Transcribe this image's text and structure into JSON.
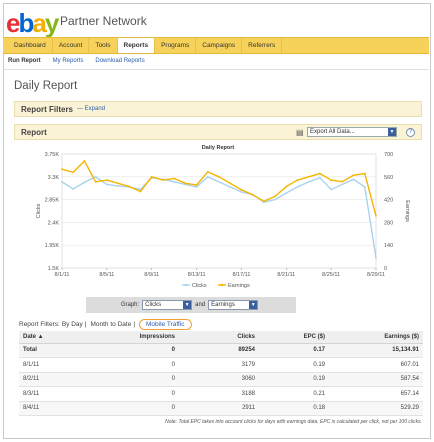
{
  "brand": {
    "logo_e": "e",
    "logo_b": "b",
    "logo_a": "a",
    "logo_y": "y",
    "name": "Partner Network"
  },
  "nav": [
    "Dashboard",
    "Account",
    "Tools",
    "Reports",
    "Programs",
    "Campaigns",
    "Referrers"
  ],
  "nav_active": "Reports",
  "subnav": [
    "Run Report",
    "My Reports",
    "Download Reports"
  ],
  "page_title": "Daily Report",
  "filters": {
    "title": "Report Filters",
    "expand": "— Expand"
  },
  "report": {
    "title": "Report",
    "export": "Export All Data...",
    "help": "?"
  },
  "chart_data": {
    "type": "line",
    "title": "Daily Report",
    "x": [
      "8/1/11",
      "8/2/11",
      "8/3/11",
      "8/4/11",
      "8/5/11",
      "8/6/11",
      "8/7/11",
      "8/8/11",
      "8/9/11",
      "8/10/11",
      "8/11/11",
      "8/12/11",
      "8/13/11",
      "8/14/11",
      "8/15/11",
      "8/16/11",
      "8/17/11",
      "8/18/11",
      "8/19/11",
      "8/20/11",
      "8/21/11",
      "8/22/11",
      "8/23/11",
      "8/24/11",
      "8/25/11",
      "8/26/11",
      "8/27/11",
      "8/28/11",
      "8/29/11"
    ],
    "xticks": [
      "8/1/11",
      "8/5/11",
      "8/9/11",
      "8/13/11",
      "8/17/11",
      "8/21/11",
      "8/25/11",
      "8/29/11"
    ],
    "ylabel": "Clicks",
    "y2label": "Earnings",
    "ylim": [
      1500,
      3750
    ],
    "y2lim": [
      0,
      700
    ],
    "yticks": [
      "3.75K",
      "3.3K",
      "2.85K",
      "2.4K",
      "1.95K",
      "1.5K"
    ],
    "y2ticks": [
      "700",
      "560",
      "420",
      "280",
      "140",
      "0"
    ],
    "series": [
      {
        "name": "Clicks",
        "color": "#a9d3ec",
        "axis": "left",
        "values": [
          3200,
          3060,
          3190,
          3300,
          3150,
          3120,
          3100,
          3050,
          3280,
          3250,
          3200,
          3150,
          3100,
          3300,
          3200,
          3100,
          3000,
          2950,
          2800,
          2850,
          2980,
          3100,
          3200,
          3280,
          3050,
          3150,
          3250,
          3100,
          1700
        ]
      },
      {
        "name": "Earnings",
        "color": "#f5b400",
        "axis": "right",
        "values": [
          607,
          588,
          657,
          529,
          540,
          520,
          500,
          470,
          560,
          540,
          550,
          520,
          510,
          590,
          560,
          520,
          480,
          450,
          410,
          440,
          500,
          540,
          560,
          580,
          540,
          530,
          570,
          580,
          320
        ]
      }
    ],
    "legend": "bottom"
  },
  "graph_controls": {
    "label": "Graph:",
    "left_metric": "Clicks",
    "and": "and",
    "right_metric": "Earnings"
  },
  "report_filters": {
    "label": "Report Filters:",
    "by_day": "By Day",
    "month_to_date": "Month to Date",
    "mobile": "Mobile Traffic"
  },
  "table": {
    "headers": [
      "Date ▲",
      "Impressions",
      "Clicks",
      "EPC ($)",
      "Earnings ($)"
    ],
    "total": [
      "Total",
      "0",
      "89254",
      "0.17",
      "15,134.91"
    ],
    "rows": [
      [
        "8/1/11",
        "0",
        "3179",
        "0.19",
        "607.01"
      ],
      [
        "8/2/11",
        "0",
        "3060",
        "0.19",
        "587.54"
      ],
      [
        "8/3/11",
        "0",
        "3188",
        "0.21",
        "657.14"
      ],
      [
        "8/4/11",
        "0",
        "2911",
        "0.18",
        "529.29"
      ]
    ]
  },
  "note": "Note: Total EPC takes into account clicks for days with earnings data. EPC is calculated per click, not per 100 clicks."
}
